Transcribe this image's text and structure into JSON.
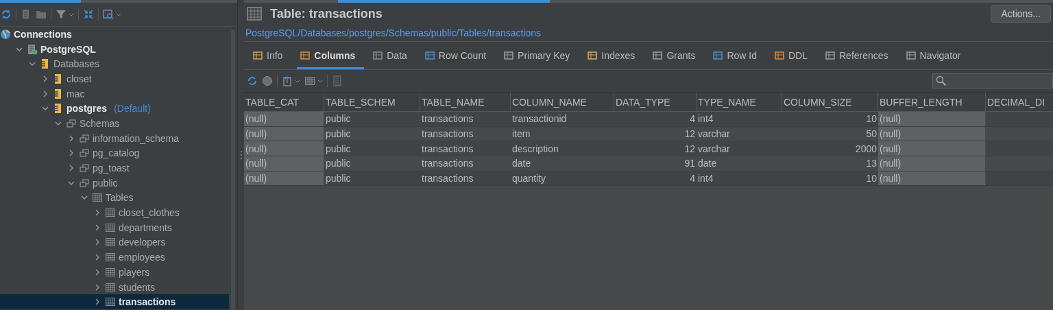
{
  "navigator": {
    "tree": [
      {
        "label": "Connections",
        "kind": "connections",
        "active": true,
        "selected": false,
        "children": [
          {
            "label": "PostgreSQL",
            "kind": "server",
            "expanded": true,
            "active": true,
            "selected": false,
            "children": [
              {
                "label": "Databases",
                "kind": "database",
                "expanded": true,
                "active": false,
                "selected": false,
                "children": [
                  {
                    "label": "closet",
                    "kind": "database",
                    "expanded": false,
                    "active": false,
                    "selected": false
                  },
                  {
                    "label": "mac",
                    "kind": "database",
                    "expanded": false,
                    "active": false,
                    "selected": false
                  },
                  {
                    "label": "postgres",
                    "badge": "(Default)",
                    "kind": "database",
                    "expanded": true,
                    "active": true,
                    "selected": false,
                    "children": [
                      {
                        "label": "Schemas",
                        "kind": "schema",
                        "expanded": true,
                        "active": false,
                        "selected": false,
                        "children": [
                          {
                            "label": "information_schema",
                            "kind": "schema",
                            "expanded": false,
                            "active": false,
                            "selected": false
                          },
                          {
                            "label": "pg_catalog",
                            "kind": "schema",
                            "expanded": false,
                            "active": false,
                            "selected": false
                          },
                          {
                            "label": "pg_toast",
                            "kind": "schema",
                            "expanded": false,
                            "active": false,
                            "selected": false
                          },
                          {
                            "label": "public",
                            "kind": "schema",
                            "expanded": true,
                            "active": false,
                            "selected": false,
                            "children": [
                              {
                                "label": "Tables",
                                "kind": "table",
                                "expanded": true,
                                "active": false,
                                "selected": false,
                                "children": [
                                  {
                                    "label": "closet_clothes",
                                    "kind": "table",
                                    "expanded": false,
                                    "active": false,
                                    "selected": false
                                  },
                                  {
                                    "label": "departments",
                                    "kind": "table",
                                    "expanded": false,
                                    "active": false,
                                    "selected": false
                                  },
                                  {
                                    "label": "developers",
                                    "kind": "table",
                                    "expanded": false,
                                    "active": false,
                                    "selected": false
                                  },
                                  {
                                    "label": "employees",
                                    "kind": "table",
                                    "expanded": false,
                                    "active": false,
                                    "selected": false
                                  },
                                  {
                                    "label": "players",
                                    "kind": "table",
                                    "expanded": false,
                                    "active": false,
                                    "selected": false
                                  },
                                  {
                                    "label": "students",
                                    "kind": "table",
                                    "expanded": false,
                                    "active": false,
                                    "selected": false
                                  },
                                  {
                                    "label": "transactions",
                                    "kind": "table",
                                    "expanded": false,
                                    "active": true,
                                    "selected": true
                                  }
                                ]
                              }
                            ]
                          }
                        ]
                      }
                    ]
                  }
                ]
              }
            ]
          }
        ]
      }
    ]
  },
  "editor": {
    "title": "Table: transactions",
    "path": "PostgreSQL/Databases/postgres/Schemas/public/Tables/transactions",
    "actions_button": "Actions...",
    "tabs": [
      {
        "label": "Info",
        "selected": false
      },
      {
        "label": "Columns",
        "selected": true
      },
      {
        "label": "Data",
        "selected": false
      },
      {
        "label": "Row Count",
        "selected": false
      },
      {
        "label": "Primary Key",
        "selected": false
      },
      {
        "label": "Indexes",
        "selected": false
      },
      {
        "label": "Grants",
        "selected": false
      },
      {
        "label": "Row Id",
        "selected": false
      },
      {
        "label": "DDL",
        "selected": false
      },
      {
        "label": "References",
        "selected": false
      },
      {
        "label": "Navigator",
        "selected": false
      }
    ],
    "table": {
      "columns": [
        {
          "label": "TABLE_CAT",
          "kind": "null"
        },
        {
          "label": "TABLE_SCHEM",
          "kind": "text"
        },
        {
          "label": "TABLE_NAME",
          "kind": "text"
        },
        {
          "label": "COLUMN_NAME",
          "kind": "text"
        },
        {
          "label": "DATA_TYPE",
          "kind": "number"
        },
        {
          "label": "TYPE_NAME",
          "kind": "text"
        },
        {
          "label": "COLUMN_SIZE",
          "kind": "number"
        },
        {
          "label": "BUFFER_LENGTH",
          "kind": "null"
        },
        {
          "label": "DECIMAL_DI",
          "kind": "text"
        }
      ],
      "rows": [
        [
          "(null)",
          "public",
          "transactions",
          "transactionid",
          "4",
          "int4",
          "10",
          "(null)"
        ],
        [
          "(null)",
          "public",
          "transactions",
          "item",
          "12",
          "varchar",
          "50",
          "(null)"
        ],
        [
          "(null)",
          "public",
          "transactions",
          "description",
          "12",
          "varchar",
          "2000",
          "(null)"
        ],
        [
          "(null)",
          "public",
          "transactions",
          "date",
          "91",
          "date",
          "13",
          "(null)"
        ],
        [
          "(null)",
          "public",
          "transactions",
          "quantity",
          "4",
          "int4",
          "10",
          "(null)"
        ]
      ]
    }
  }
}
